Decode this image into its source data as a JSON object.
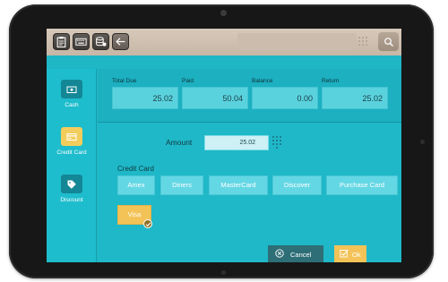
{
  "colors": {
    "accent_teal": "#1fb6c6",
    "selected_yellow": "#f3c357",
    "cancel_dark": "#2e6e76",
    "topbar_beige": "#cdbfb2"
  },
  "toolbar": {
    "icons": [
      "clipboard-icon",
      "keyboard-icon",
      "database-user-icon",
      "back-arrow-icon"
    ],
    "search": {
      "value": "",
      "placeholder": ""
    },
    "search_icon": "search-icon"
  },
  "sidebar": {
    "items": [
      {
        "label": "Cash",
        "icon": "cash-icon",
        "active": false
      },
      {
        "label": "Credit Card",
        "icon": "credit-card-icon",
        "active": true
      },
      {
        "label": "Discount",
        "icon": "tag-icon",
        "active": false
      }
    ]
  },
  "summary": {
    "total_due": {
      "label": "Total Due",
      "value": "25.02"
    },
    "paid": {
      "label": "Paid",
      "value": "50.04"
    },
    "balance": {
      "label": "Balance",
      "value": "0.00"
    },
    "return": {
      "label": "Return",
      "value": "25.02"
    }
  },
  "payment": {
    "amount_label": "Amount",
    "amount_value": "25.02",
    "credit_card_label": "Credit Card",
    "cards": [
      "Amex",
      "Diners",
      "MasterCard",
      "Discover",
      "Purchase Card"
    ],
    "selected_card": "Visa"
  },
  "actions": {
    "cancel_label": "Cancel",
    "ok_label": "Ok"
  }
}
